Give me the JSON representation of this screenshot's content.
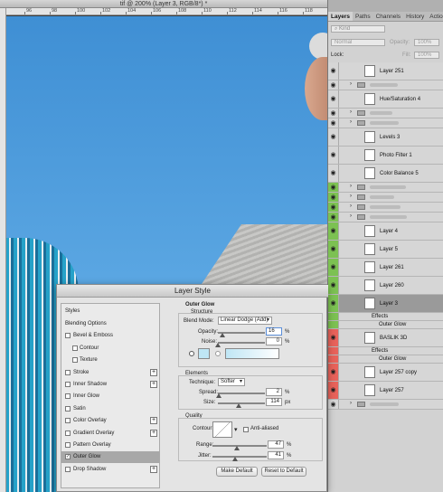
{
  "document": {
    "title": "tif @ 200% (Layer 3, RGB/8*) *"
  },
  "ruler": {
    "ticks": [
      "96",
      "98",
      "100",
      "102",
      "104",
      "106",
      "108",
      "110",
      "112",
      "114",
      "116",
      "118"
    ]
  },
  "panel": {
    "tabs": [
      "Layers",
      "Paths",
      "Channels",
      "History",
      "Actions"
    ],
    "filter_label": "Kind",
    "blend_mode": "Normal",
    "opacity_label": "Opacity:",
    "opacity_value": "100%",
    "lock_label": "Lock:",
    "fill_label": "Fill:",
    "fill_value": "100%",
    "layers": [
      {
        "name": "Layer 251",
        "visible": true
      },
      {
        "name": "",
        "visible": true,
        "group": true
      },
      {
        "name": "Hue/Saturation 4",
        "visible": true
      },
      {
        "name": "",
        "visible": true,
        "group": true
      },
      {
        "name": "",
        "visible": true,
        "group": true
      },
      {
        "name": "Levels 3",
        "visible": true
      },
      {
        "name": "Photo Filter 1",
        "visible": true
      },
      {
        "name": "Color Balance 5",
        "visible": true
      },
      {
        "name": "",
        "visible": true,
        "group": true
      },
      {
        "name": "",
        "visible": true,
        "group": true
      },
      {
        "name": "",
        "visible": true,
        "group": true
      },
      {
        "name": "",
        "visible": true,
        "group": true
      },
      {
        "name": "Layer 4",
        "visible": true
      },
      {
        "name": "Layer 5",
        "visible": true
      },
      {
        "name": "Layer 261",
        "visible": true
      },
      {
        "name": "Layer 260",
        "visible": true
      },
      {
        "name": "Layer 3",
        "visible": true,
        "selected": true
      },
      {
        "name": "Effects",
        "visible": false,
        "sub": true
      },
      {
        "name": "Outer Glow",
        "visible": false,
        "sub": true
      },
      {
        "name": "BASLIK 3D",
        "visible": true
      },
      {
        "name": "Effects",
        "visible": false,
        "sub": true
      },
      {
        "name": "Outer Glow",
        "visible": false,
        "sub": true
      },
      {
        "name": "Layer 257 copy",
        "visible": true
      },
      {
        "name": "Layer 257",
        "visible": true
      },
      {
        "name": "",
        "visible": true,
        "group": true
      }
    ],
    "colors": {
      "green": "#7cc152",
      "red": "#e8625a"
    }
  },
  "dialog": {
    "title": "Layer Style",
    "styles": [
      {
        "label": "Styles",
        "checkbox": false,
        "plus": false
      },
      {
        "label": "Blending Options",
        "checkbox": false,
        "plus": false
      },
      {
        "label": "Bevel & Emboss",
        "checkbox": true,
        "plus": false
      },
      {
        "label": "Contour",
        "checkbox": true,
        "plus": false,
        "indent": true
      },
      {
        "label": "Texture",
        "checkbox": true,
        "plus": false,
        "indent": true
      },
      {
        "label": "Stroke",
        "checkbox": true,
        "plus": true
      },
      {
        "label": "Inner Shadow",
        "checkbox": true,
        "plus": true
      },
      {
        "label": "Inner Glow",
        "checkbox": true,
        "plus": false
      },
      {
        "label": "Satin",
        "checkbox": true,
        "plus": false
      },
      {
        "label": "Color Overlay",
        "checkbox": true,
        "plus": true
      },
      {
        "label": "Gradient Overlay",
        "checkbox": true,
        "plus": true
      },
      {
        "label": "Pattern Overlay",
        "checkbox": true,
        "plus": false
      },
      {
        "label": "Outer Glow",
        "checkbox": true,
        "plus": false,
        "checked": true,
        "selected": true
      },
      {
        "label": "Drop Shadow",
        "checkbox": true,
        "plus": true
      }
    ],
    "outer_glow": {
      "section": "Outer Glow",
      "structure": "Structure",
      "blend_mode_label": "Blend Mode:",
      "blend_mode": "Linear Dodge (Add)",
      "opacity_label": "Opacity:",
      "opacity": "16",
      "noise_label": "Noise:",
      "noise": "0",
      "pct": "%",
      "elements": "Elements",
      "technique_label": "Technique:",
      "technique": "Softer",
      "spread_label": "Spread:",
      "spread": "2",
      "size_label": "Size:",
      "size": "114",
      "px": "px",
      "quality": "Quality",
      "contour_label": "Contour:",
      "anti_aliased": "Anti-aliased",
      "range_label": "Range:",
      "range": "47",
      "jitter_label": "Jitter:",
      "jitter": "41",
      "glow_color": "#bfe6f5"
    },
    "make_default": "Make Default",
    "reset_default": "Reset to Default"
  }
}
